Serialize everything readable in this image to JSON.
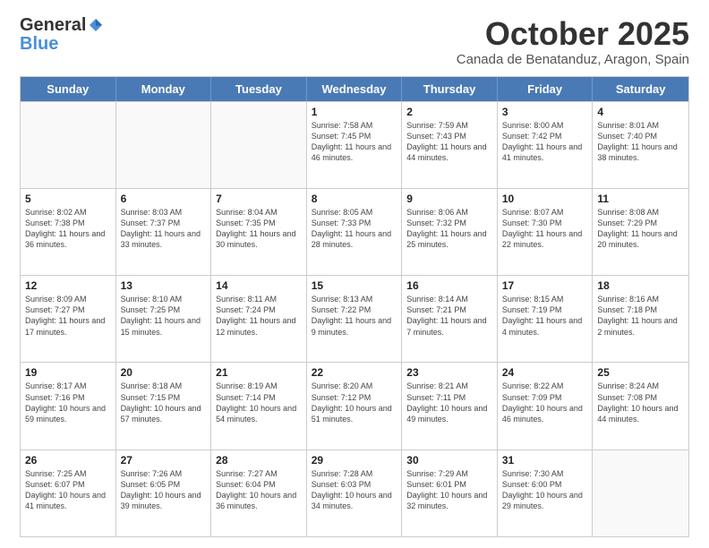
{
  "logo": {
    "general": "General",
    "blue": "Blue"
  },
  "header": {
    "month": "October 2025",
    "location": "Canada de Benatanduz, Aragon, Spain"
  },
  "days_of_week": [
    "Sunday",
    "Monday",
    "Tuesday",
    "Wednesday",
    "Thursday",
    "Friday",
    "Saturday"
  ],
  "weeks": [
    [
      {
        "day": "",
        "empty": true
      },
      {
        "day": "",
        "empty": true
      },
      {
        "day": "",
        "empty": true
      },
      {
        "day": "1",
        "sunrise": "7:58 AM",
        "sunset": "7:45 PM",
        "daylight": "11 hours and 46 minutes."
      },
      {
        "day": "2",
        "sunrise": "7:59 AM",
        "sunset": "7:43 PM",
        "daylight": "11 hours and 44 minutes."
      },
      {
        "day": "3",
        "sunrise": "8:00 AM",
        "sunset": "7:42 PM",
        "daylight": "11 hours and 41 minutes."
      },
      {
        "day": "4",
        "sunrise": "8:01 AM",
        "sunset": "7:40 PM",
        "daylight": "11 hours and 38 minutes."
      }
    ],
    [
      {
        "day": "5",
        "sunrise": "8:02 AM",
        "sunset": "7:38 PM",
        "daylight": "11 hours and 36 minutes."
      },
      {
        "day": "6",
        "sunrise": "8:03 AM",
        "sunset": "7:37 PM",
        "daylight": "11 hours and 33 minutes."
      },
      {
        "day": "7",
        "sunrise": "8:04 AM",
        "sunset": "7:35 PM",
        "daylight": "11 hours and 30 minutes."
      },
      {
        "day": "8",
        "sunrise": "8:05 AM",
        "sunset": "7:33 PM",
        "daylight": "11 hours and 28 minutes."
      },
      {
        "day": "9",
        "sunrise": "8:06 AM",
        "sunset": "7:32 PM",
        "daylight": "11 hours and 25 minutes."
      },
      {
        "day": "10",
        "sunrise": "8:07 AM",
        "sunset": "7:30 PM",
        "daylight": "11 hours and 22 minutes."
      },
      {
        "day": "11",
        "sunrise": "8:08 AM",
        "sunset": "7:29 PM",
        "daylight": "11 hours and 20 minutes."
      }
    ],
    [
      {
        "day": "12",
        "sunrise": "8:09 AM",
        "sunset": "7:27 PM",
        "daylight": "11 hours and 17 minutes."
      },
      {
        "day": "13",
        "sunrise": "8:10 AM",
        "sunset": "7:25 PM",
        "daylight": "11 hours and 15 minutes."
      },
      {
        "day": "14",
        "sunrise": "8:11 AM",
        "sunset": "7:24 PM",
        "daylight": "11 hours and 12 minutes."
      },
      {
        "day": "15",
        "sunrise": "8:13 AM",
        "sunset": "7:22 PM",
        "daylight": "11 hours and 9 minutes."
      },
      {
        "day": "16",
        "sunrise": "8:14 AM",
        "sunset": "7:21 PM",
        "daylight": "11 hours and 7 minutes."
      },
      {
        "day": "17",
        "sunrise": "8:15 AM",
        "sunset": "7:19 PM",
        "daylight": "11 hours and 4 minutes."
      },
      {
        "day": "18",
        "sunrise": "8:16 AM",
        "sunset": "7:18 PM",
        "daylight": "11 hours and 2 minutes."
      }
    ],
    [
      {
        "day": "19",
        "sunrise": "8:17 AM",
        "sunset": "7:16 PM",
        "daylight": "10 hours and 59 minutes."
      },
      {
        "day": "20",
        "sunrise": "8:18 AM",
        "sunset": "7:15 PM",
        "daylight": "10 hours and 57 minutes."
      },
      {
        "day": "21",
        "sunrise": "8:19 AM",
        "sunset": "7:14 PM",
        "daylight": "10 hours and 54 minutes."
      },
      {
        "day": "22",
        "sunrise": "8:20 AM",
        "sunset": "7:12 PM",
        "daylight": "10 hours and 51 minutes."
      },
      {
        "day": "23",
        "sunrise": "8:21 AM",
        "sunset": "7:11 PM",
        "daylight": "10 hours and 49 minutes."
      },
      {
        "day": "24",
        "sunrise": "8:22 AM",
        "sunset": "7:09 PM",
        "daylight": "10 hours and 46 minutes."
      },
      {
        "day": "25",
        "sunrise": "8:24 AM",
        "sunset": "7:08 PM",
        "daylight": "10 hours and 44 minutes."
      }
    ],
    [
      {
        "day": "26",
        "sunrise": "7:25 AM",
        "sunset": "6:07 PM",
        "daylight": "10 hours and 41 minutes."
      },
      {
        "day": "27",
        "sunrise": "7:26 AM",
        "sunset": "6:05 PM",
        "daylight": "10 hours and 39 minutes."
      },
      {
        "day": "28",
        "sunrise": "7:27 AM",
        "sunset": "6:04 PM",
        "daylight": "10 hours and 36 minutes."
      },
      {
        "day": "29",
        "sunrise": "7:28 AM",
        "sunset": "6:03 PM",
        "daylight": "10 hours and 34 minutes."
      },
      {
        "day": "30",
        "sunrise": "7:29 AM",
        "sunset": "6:01 PM",
        "daylight": "10 hours and 32 minutes."
      },
      {
        "day": "31",
        "sunrise": "7:30 AM",
        "sunset": "6:00 PM",
        "daylight": "10 hours and 29 minutes."
      },
      {
        "day": "",
        "empty": true
      }
    ]
  ]
}
